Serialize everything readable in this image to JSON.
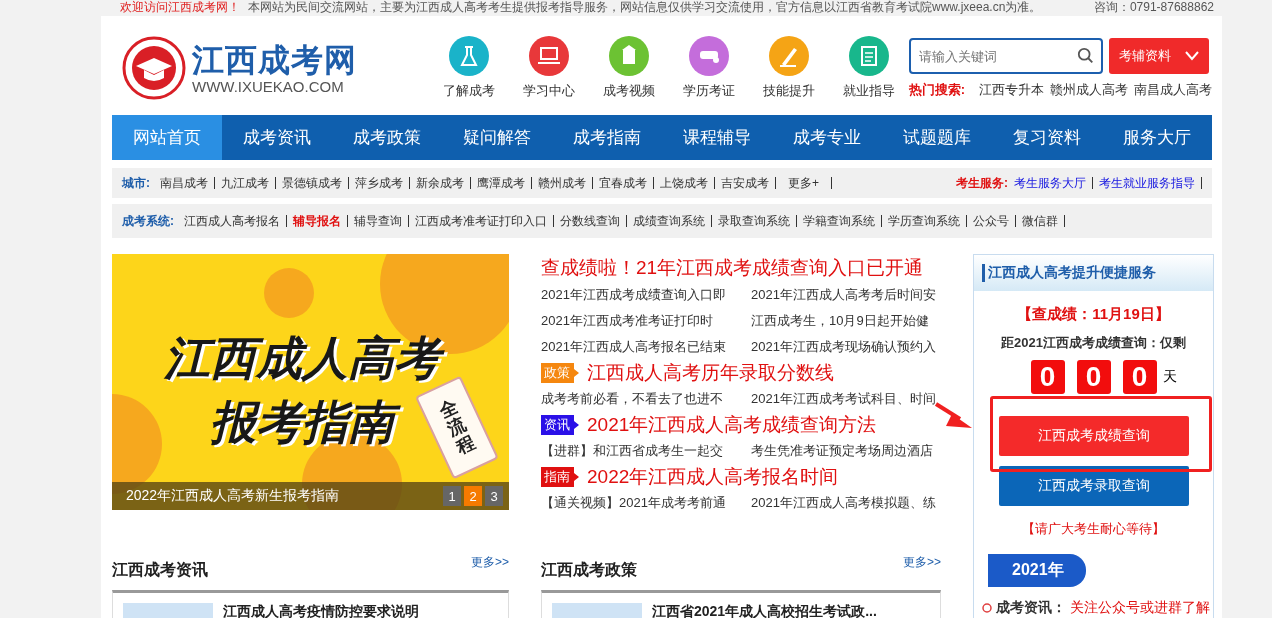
{
  "top_bar": {
    "welcome": "欢迎访问江西成考网！",
    "notice": "本网站为民间交流网站，主要为江西成人高考考生提供报考指导服务，网站信息仅供学习交流使用，官方信息以江西省教育考试院www.jxeea.cn为准。",
    "contact": "咨询：0791-87688862"
  },
  "header": {
    "logo": {
      "title": "江西成考网",
      "url": "WWW.IXUEKAO.COM"
    },
    "quick_links": [
      {
        "label": "了解成考",
        "color": "#1ab3c9",
        "kind": "flask"
      },
      {
        "label": "学习中心",
        "color": "#e8383a",
        "kind": "laptop"
      },
      {
        "label": "成考视频",
        "color": "#6cc233",
        "kind": "building"
      },
      {
        "label": "学历考证",
        "color": "#c46ddb",
        "kind": "scroll"
      },
      {
        "label": "技能提升",
        "color": "#f5a415",
        "kind": "pen"
      },
      {
        "label": "就业指导",
        "color": "#18b78c",
        "kind": "clipboard"
      }
    ],
    "search": {
      "placeholder": "请输入关键词"
    },
    "materials_button": {
      "label": "考辅资料"
    },
    "hot_search": {
      "label": "热门搜索:",
      "items": [
        "江西专升本",
        "赣州成人高考",
        "南昌成人高考"
      ]
    }
  },
  "nav": [
    {
      "label": "网站首页",
      "selected": true
    },
    {
      "label": "成考资讯",
      "selected": false
    },
    {
      "label": "成考政策",
      "selected": false
    },
    {
      "label": "疑问解答",
      "selected": false
    },
    {
      "label": "成考指南",
      "selected": false
    },
    {
      "label": "课程辅导",
      "selected": false
    },
    {
      "label": "成考专业",
      "selected": false
    },
    {
      "label": "试题题库",
      "selected": false
    },
    {
      "label": "复习资料",
      "selected": false
    },
    {
      "label": "服务大厅",
      "selected": false
    }
  ],
  "city_bar": {
    "label": "城市:",
    "items": [
      "南昌成考",
      "九江成考",
      "景德镇成考",
      "萍乡成考",
      "新余成考",
      "鹰潭成考",
      "赣州成考",
      "宜春成考",
      "上饶成考",
      "吉安成考"
    ],
    "more": "更多+",
    "service_label": "考生服务:",
    "service_links": [
      "考生服务大厅",
      "考生就业服务指导"
    ]
  },
  "system_bar": {
    "label": "成考系统:",
    "items": [
      {
        "label": "江西成人高考报名",
        "highlighted": false
      },
      {
        "label": "辅导报名",
        "highlighted": true
      },
      {
        "label": "辅导查询",
        "highlighted": false
      },
      {
        "label": "江西成考准考证打印入口",
        "highlighted": false
      },
      {
        "label": "分数线查询",
        "highlighted": false
      },
      {
        "label": "成绩查询系统",
        "highlighted": false
      },
      {
        "label": "录取查询系统",
        "highlighted": false
      },
      {
        "label": "学籍查询系统",
        "highlighted": false
      },
      {
        "label": "学历查询系统",
        "highlighted": false
      },
      {
        "label": "公众号",
        "highlighted": false
      },
      {
        "label": "微信群",
        "highlighted": false
      }
    ]
  },
  "slider": {
    "title_lines": [
      "江西成人高考",
      "报考指南"
    ],
    "tag": "全流程",
    "caption": "2022年江西成人高考新生报考指南",
    "pages": [
      {
        "label": "1",
        "selected": false
      },
      {
        "label": "2",
        "selected": true
      },
      {
        "label": "3",
        "selected": false
      }
    ]
  },
  "news": {
    "headline": "查成绩啦！21年江西成考成绩查询入口已开通",
    "links": [
      "2021年江西成考成绩查询入口即",
      "2021年江西成人高考考后时间安",
      "2021年江西成考准考证打印时",
      "江西成考生，10月9日起开始健",
      "2021年江西成人高考报名已结束",
      "2021年江西成考现场确认预约入"
    ],
    "sections": [
      {
        "badge": "政策",
        "color": "#f5870f",
        "title": "江西成人高考历年录取分数线",
        "links": [
          "成考考前必看，不看去了也进不",
          "2021年江西成考考试科目、时间"
        ]
      },
      {
        "badge": "资讯",
        "color": "#2a10e8",
        "title": "2021年江西成人高考成绩查询方法",
        "links": [
          "【进群】和江西省成考生一起交",
          "考生凭准考证预定考场周边酒店"
        ]
      },
      {
        "badge": "指南",
        "color": "#e01010",
        "title": "2022年江西成人高考报名时间",
        "links": [
          "【通关视频】2021年成考考前通",
          "2021年江西成人高考模拟题、练"
        ]
      }
    ]
  },
  "service_panel": {
    "title": "江西成人高考提升便捷服务",
    "date_notice": "【查成绩：11月19日】",
    "countdown_label": "距2021江西成考成绩查询：仅剩",
    "digits": [
      "0",
      "0",
      "0"
    ],
    "unit": "天",
    "buttons": [
      {
        "label": "江西成考成绩查询",
        "kind": "primary"
      },
      {
        "label": "江西成考录取查询",
        "kind": "secondary"
      }
    ],
    "wait_notice": "【请广大考生耐心等待】",
    "year_tab": "2021年",
    "timeline": [
      {
        "label": "成考资讯：",
        "text": "关注公众号或进群了解"
      }
    ]
  },
  "sections": [
    {
      "title": "江西成考资讯",
      "more": "更多>>",
      "items": [
        {
          "title": "江西成人高考疫情防控要求说明"
        }
      ]
    },
    {
      "title": "江西成考政策",
      "more": "更多>>",
      "items": [
        {
          "title": "江西省2021年成人高校招生考试政..."
        }
      ]
    }
  ]
}
